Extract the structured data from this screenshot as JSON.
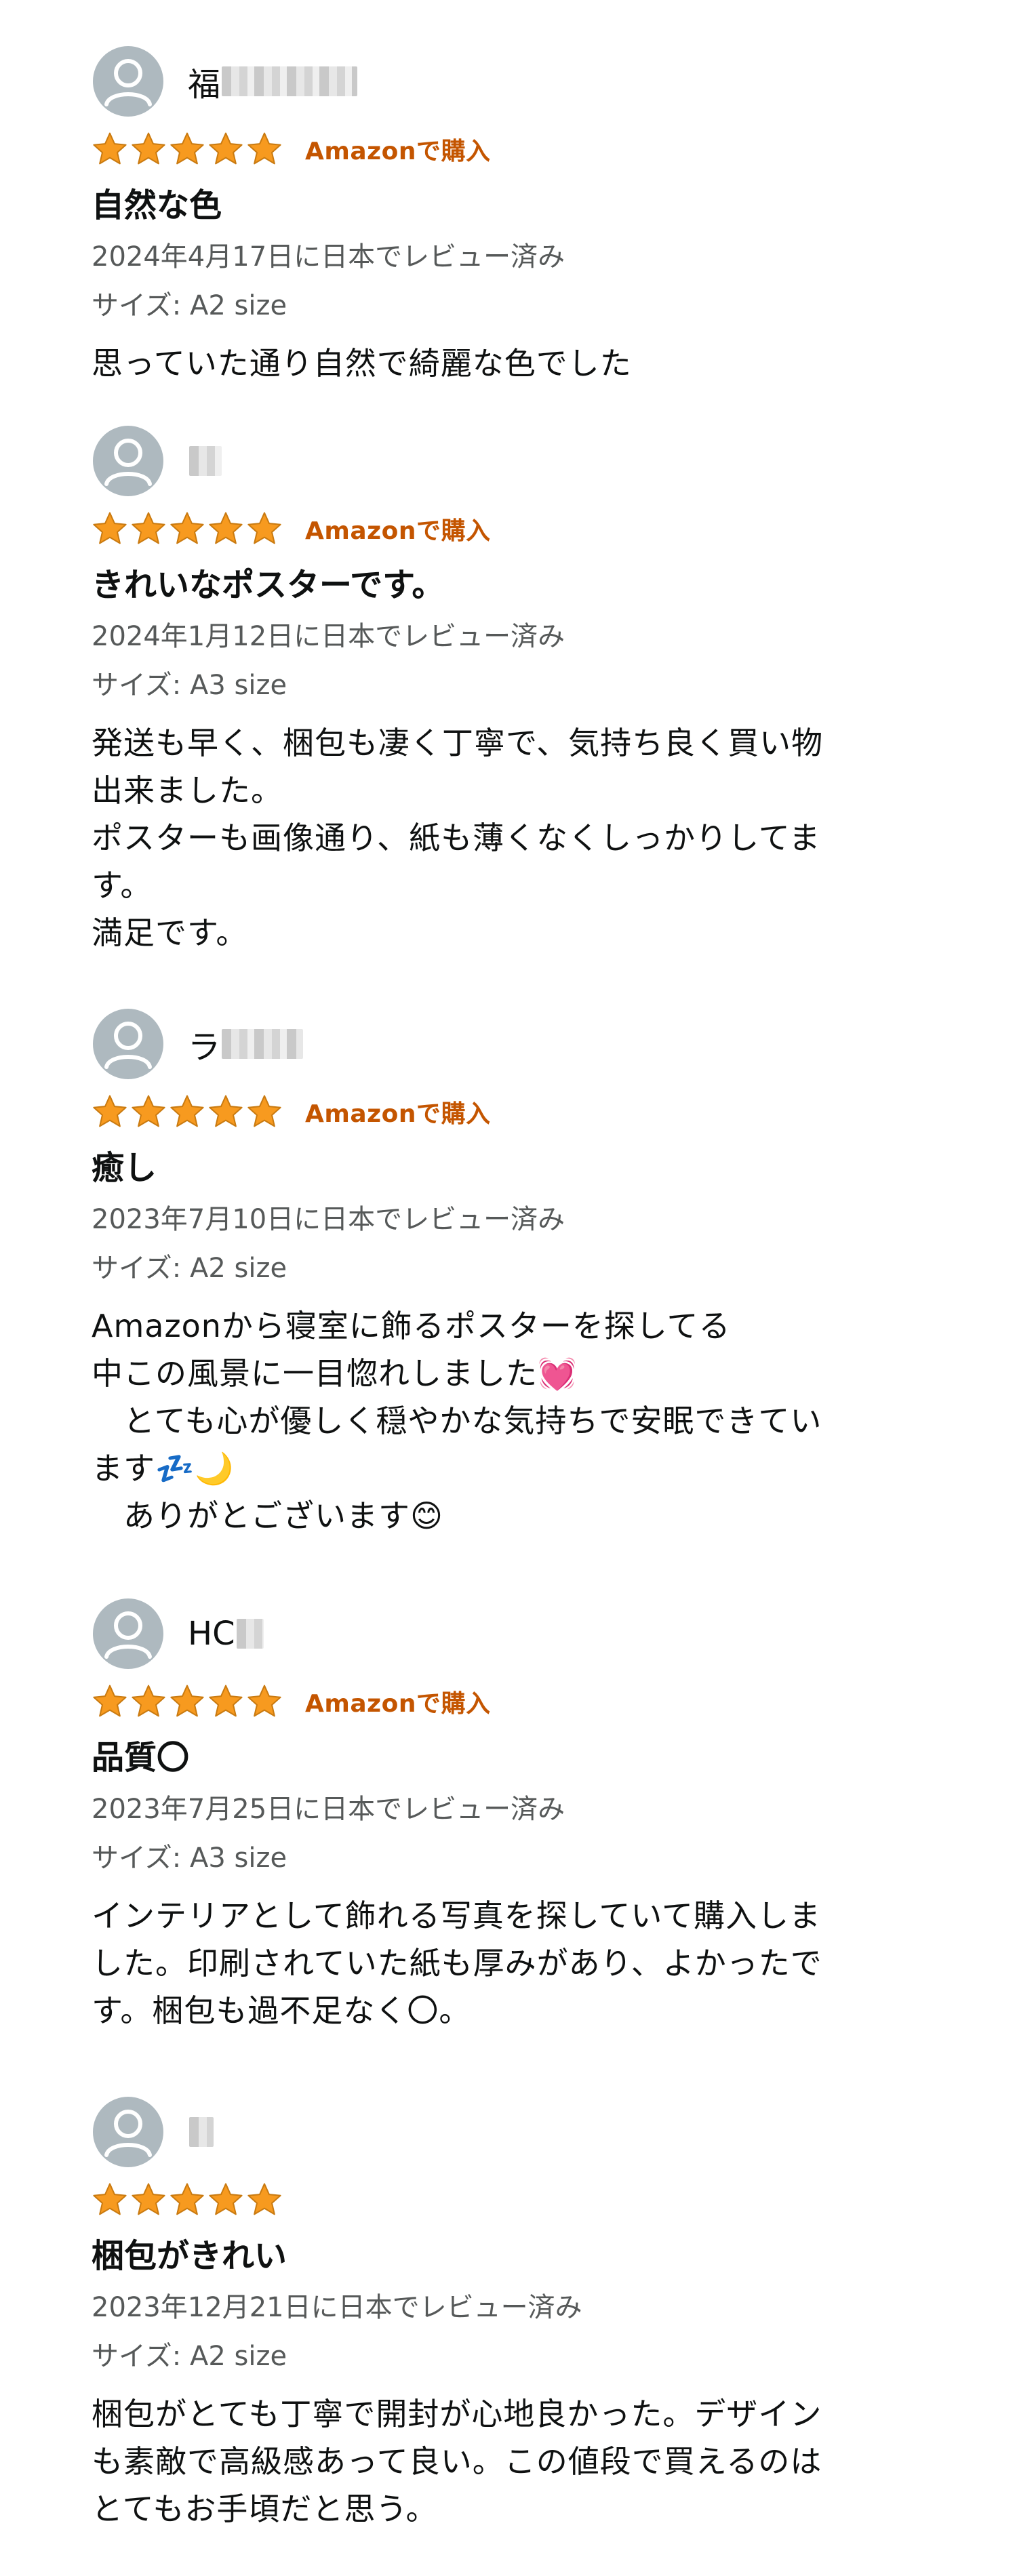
{
  "reviews": [
    {
      "reviewer": "福",
      "rating": 5,
      "verified": "Amazonで購入",
      "title": "自然な色",
      "date": "2024年4月17日に日本でレビュー済み",
      "variant": "サイズ: A2 size",
      "body": "思っていた通り自然で綺麗な色でした"
    },
    {
      "reviewer": "",
      "rating": 5,
      "verified": "Amazonで購入",
      "title": "きれいなポスターです。",
      "date": "2024年1月12日に日本でレビュー済み",
      "variant": "サイズ: A3 size",
      "body": "発送も早く、梱包も凄く丁寧で、気持ち良く買い物\n出来ました。\nポスターも画像通り、紙も薄くなくしっかりしてま\nす。\n満足です。"
    },
    {
      "reviewer": "ラ",
      "rating": 5,
      "verified": "Amazonで購入",
      "title": "癒し",
      "date": "2023年7月10日に日本でレビュー済み",
      "variant": "サイズ: A2 size",
      "body": "Amazonから寝室に飾るポスターを探してる\n中この風景に一目惚れしました💓\n　とても心が優しく穏やかな気持ちで安眠できてい\nます💤🌙\n　ありがとございます😊"
    },
    {
      "reviewer": "HC",
      "rating": 5,
      "verified": "Amazonで購入",
      "title": "品質〇",
      "date": "2023年7月25日に日本でレビュー済み",
      "variant": "サイズ: A3 size",
      "body": "インテリアとして飾れる写真を探していて購入しま\nした。印刷されていた紙も厚みがあり、よかったで\nす。梱包も過不足なく〇。"
    },
    {
      "reviewer": "",
      "rating": 5,
      "verified": "",
      "title": "梱包がきれい",
      "date": "2023年12月21日に日本でレビュー済み",
      "variant": "サイズ: A2 size",
      "body": "梱包がとても丁寧で開封が心地良かった。デザイン\nも素敵で高級感あって良い。この値段で買えるのは\nとてもお手頃だと思う。"
    }
  ],
  "colors": {
    "star": "#f79a1f",
    "verified": "#c45500",
    "muted": "#565959"
  }
}
